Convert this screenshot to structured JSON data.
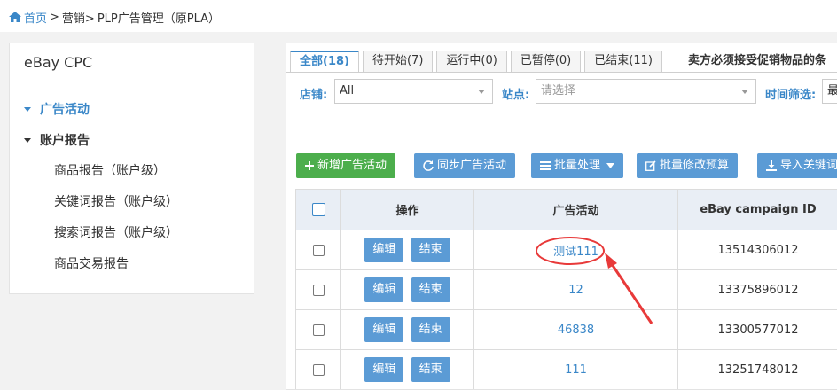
{
  "breadcrumb": {
    "home": "首页",
    "sep1": ">",
    "marketing": "营销>",
    "current": "PLP广告管理（原PLA）"
  },
  "sidebar": {
    "title": "eBay CPC",
    "items": [
      {
        "label": "广告活动"
      },
      {
        "label": "账户报告"
      }
    ],
    "subitems": [
      {
        "label": "商品报告（账户级）"
      },
      {
        "label": "关键词报告（账户级）"
      },
      {
        "label": "搜索词报告（账户级）"
      },
      {
        "label": "商品交易报告"
      }
    ]
  },
  "tabs": [
    {
      "label": "全部(18)"
    },
    {
      "label": "待开始(7)"
    },
    {
      "label": "运行中(0)"
    },
    {
      "label": "已暂停(0)"
    },
    {
      "label": "已结束(11)"
    }
  ],
  "notice": "卖方必须接受促销物品的条",
  "filters": {
    "shop_label": "店铺:",
    "shop_value": "All",
    "site_label": "站点:",
    "site_placeholder": "请选择",
    "time_label": "时间筛选:",
    "time_value": "最"
  },
  "actions": {
    "add": "新增广告活动",
    "sync": "同步广告活动",
    "batch": "批量处理",
    "budget": "批量修改预算",
    "import": "导入关键词"
  },
  "table": {
    "headers": {
      "op": "操作",
      "campaign": "广告活动",
      "campaign_id": "eBay campaign ID"
    },
    "edit_label": "编辑",
    "end_label": "结束",
    "rows": [
      {
        "campaign": "测试111",
        "campaign_id": "13514306012"
      },
      {
        "campaign": "12",
        "campaign_id": "13375896012"
      },
      {
        "campaign": "46838",
        "campaign_id": "13300577012"
      },
      {
        "campaign": "111",
        "campaign_id": "13251748012"
      }
    ]
  },
  "colors": {
    "accent": "#3a87c8",
    "button_blue": "#5b9bd5",
    "button_green": "#4cae4c",
    "annotation": "#e83a3a"
  }
}
